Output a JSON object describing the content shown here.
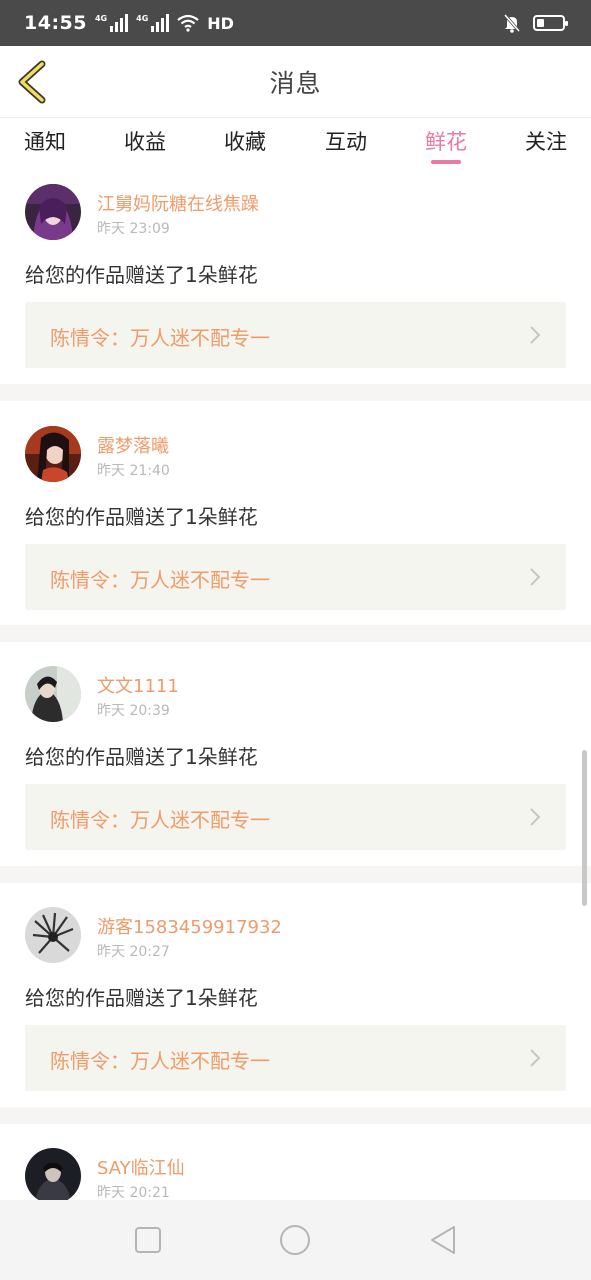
{
  "status_bar": {
    "time": "14:55",
    "signal_1_label": "4G",
    "signal_2_label": "4G",
    "hd_label": "HD",
    "icons": [
      "signal-icon",
      "signal-icon",
      "wifi-icon",
      "mute-icon",
      "battery-icon"
    ]
  },
  "header": {
    "title": "消息",
    "back_icon": "chevron-left-icon"
  },
  "tabs": {
    "items": [
      {
        "label": "通知"
      },
      {
        "label": "收益"
      },
      {
        "label": "收藏"
      },
      {
        "label": "互动"
      },
      {
        "label": "鲜花"
      },
      {
        "label": "关注"
      }
    ],
    "active": "鲜花",
    "accent_color": "#e77ba5"
  },
  "feed": {
    "items": [
      {
        "username": "江舅妈阮糖在线焦躁",
        "time": "昨天 23:09",
        "message": "给您的作品赠送了1朵鲜花",
        "work_title": "陈情令：万人迷不配专一"
      },
      {
        "username": "露梦落曦",
        "time": "昨天 21:40",
        "message": "给您的作品赠送了1朵鲜花",
        "work_title": "陈情令：万人迷不配专一"
      },
      {
        "username": "文文1111",
        "time": "昨天 20:39",
        "message": "给您的作品赠送了1朵鲜花",
        "work_title": "陈情令：万人迷不配专一"
      },
      {
        "username": "游客1583459917932",
        "time": "昨天 20:27",
        "message": "给您的作品赠送了1朵鲜花",
        "work_title": "陈情令：万人迷不配专一"
      },
      {
        "username": "SAY临江仙",
        "time": "昨天 20:21"
      }
    ],
    "name_color": "#ef9b6a"
  },
  "nav_bar": {
    "icons": [
      "square-icon",
      "circle-icon",
      "triangle-back-icon"
    ]
  }
}
